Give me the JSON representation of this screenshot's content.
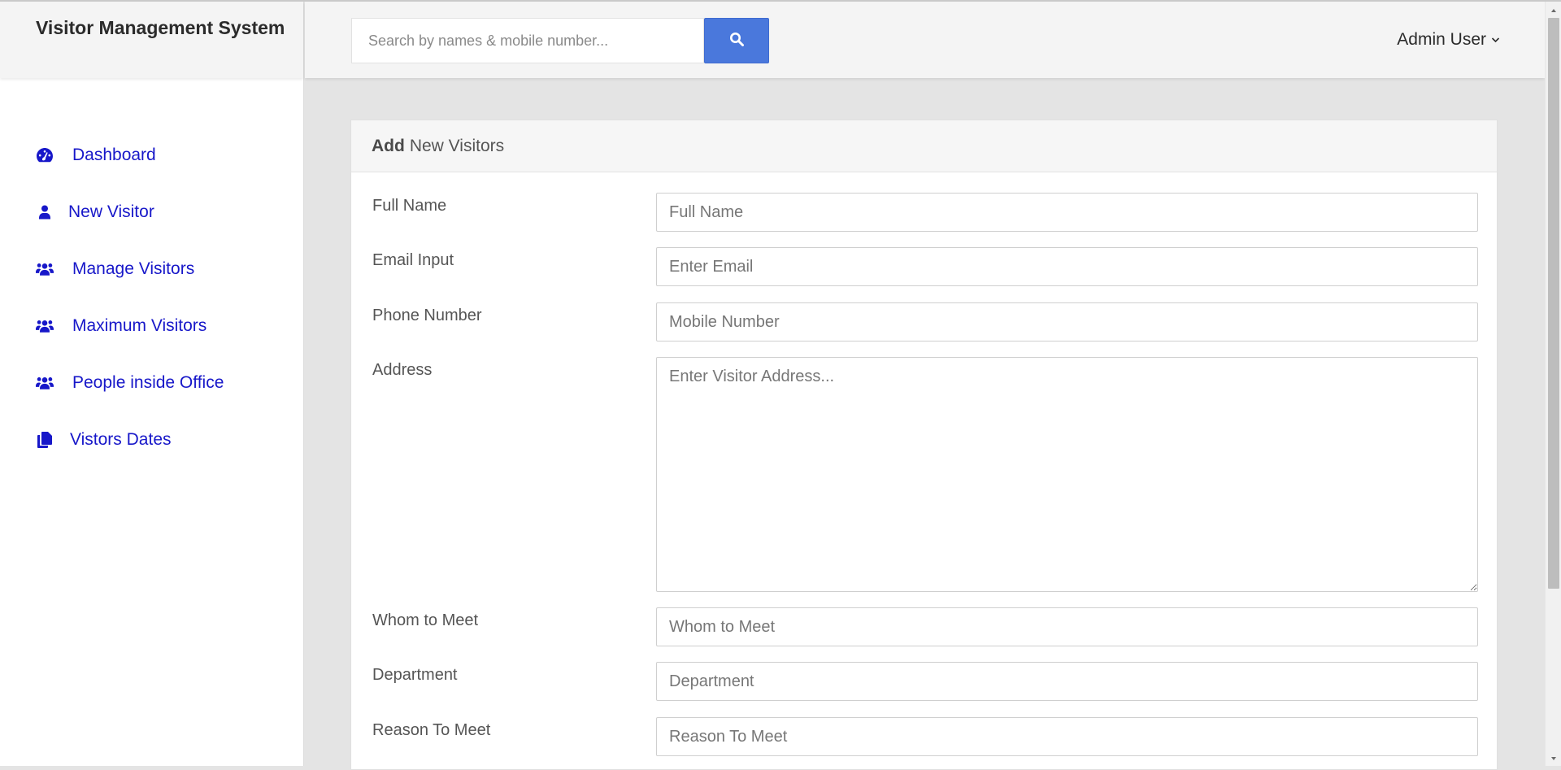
{
  "app": {
    "title": "Visitor Management System"
  },
  "search": {
    "placeholder": "Search by names & mobile number...",
    "button_icon": "search-icon"
  },
  "user_menu": {
    "label": "Admin User",
    "icon": "chevron-down-icon"
  },
  "sidebar": {
    "items": [
      {
        "label": "Dashboard",
        "icon": "tachometer-icon"
      },
      {
        "label": "New Visitor",
        "icon": "user-icon"
      },
      {
        "label": "Manage Visitors",
        "icon": "users-icon"
      },
      {
        "label": "Maximum Visitors",
        "icon": "users-icon"
      },
      {
        "label": "People inside Office",
        "icon": "users-icon"
      },
      {
        "label": "Vistors Dates",
        "icon": "copy-icon"
      }
    ]
  },
  "form": {
    "header_bold": "Add",
    "header_rest": "New Visitors",
    "fields": [
      {
        "label": "Full Name",
        "placeholder": "Full Name"
      },
      {
        "label": "Email Input",
        "placeholder": "Enter Email"
      },
      {
        "label": "Phone Number",
        "placeholder": "Mobile Number"
      },
      {
        "label": "Address",
        "placeholder": "Enter Visitor Address..."
      },
      {
        "label": "Whom to Meet",
        "placeholder": "Whom to Meet"
      },
      {
        "label": "Department",
        "placeholder": "Department"
      },
      {
        "label": "Reason To Meet",
        "placeholder": "Reason To Meet"
      }
    ]
  },
  "colors": {
    "nav_link": "#1717c9",
    "search_button": "#4a78dc",
    "panel_bg": "#f4f4f4",
    "content_bg": "#e4e4e4"
  }
}
